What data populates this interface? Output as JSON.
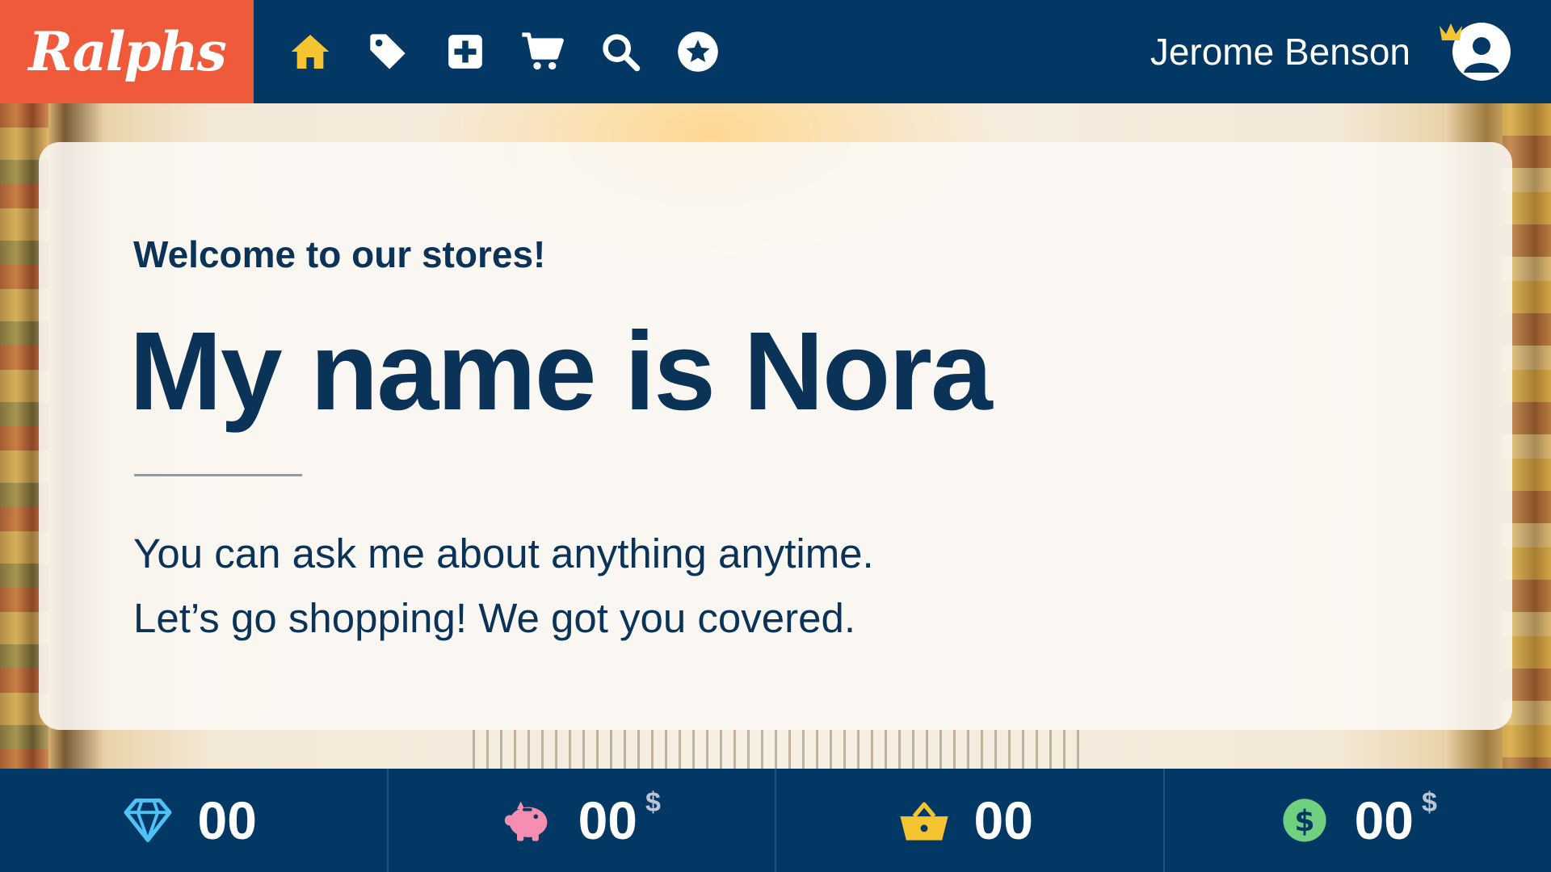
{
  "brand": {
    "name": "Ralphs",
    "color": "#ef5a3b"
  },
  "colors": {
    "nav": "#033865",
    "text": "#0b3358",
    "home_active": "#f4c431"
  },
  "nav": {
    "icons": [
      {
        "name": "home-icon",
        "active": true
      },
      {
        "name": "tag-icon"
      },
      {
        "name": "plus-square-icon"
      },
      {
        "name": "cart-icon"
      },
      {
        "name": "search-icon"
      },
      {
        "name": "star-icon"
      }
    ]
  },
  "user": {
    "name": "Jerome Benson",
    "badge": "crown-icon"
  },
  "card": {
    "welcome": "Welcome to our stores!",
    "headline": "My name is Nora",
    "line1": "You can ask me about anything anytime.",
    "line2": "Let’s go shopping! We got you covered."
  },
  "stats": [
    {
      "icon": "diamond-icon",
      "value": "00",
      "unit": ""
    },
    {
      "icon": "piggy-bank-icon",
      "value": "00",
      "unit": "$"
    },
    {
      "icon": "basket-icon",
      "value": "00",
      "unit": ""
    },
    {
      "icon": "dollar-coin-icon",
      "value": "00",
      "unit": "$"
    }
  ]
}
